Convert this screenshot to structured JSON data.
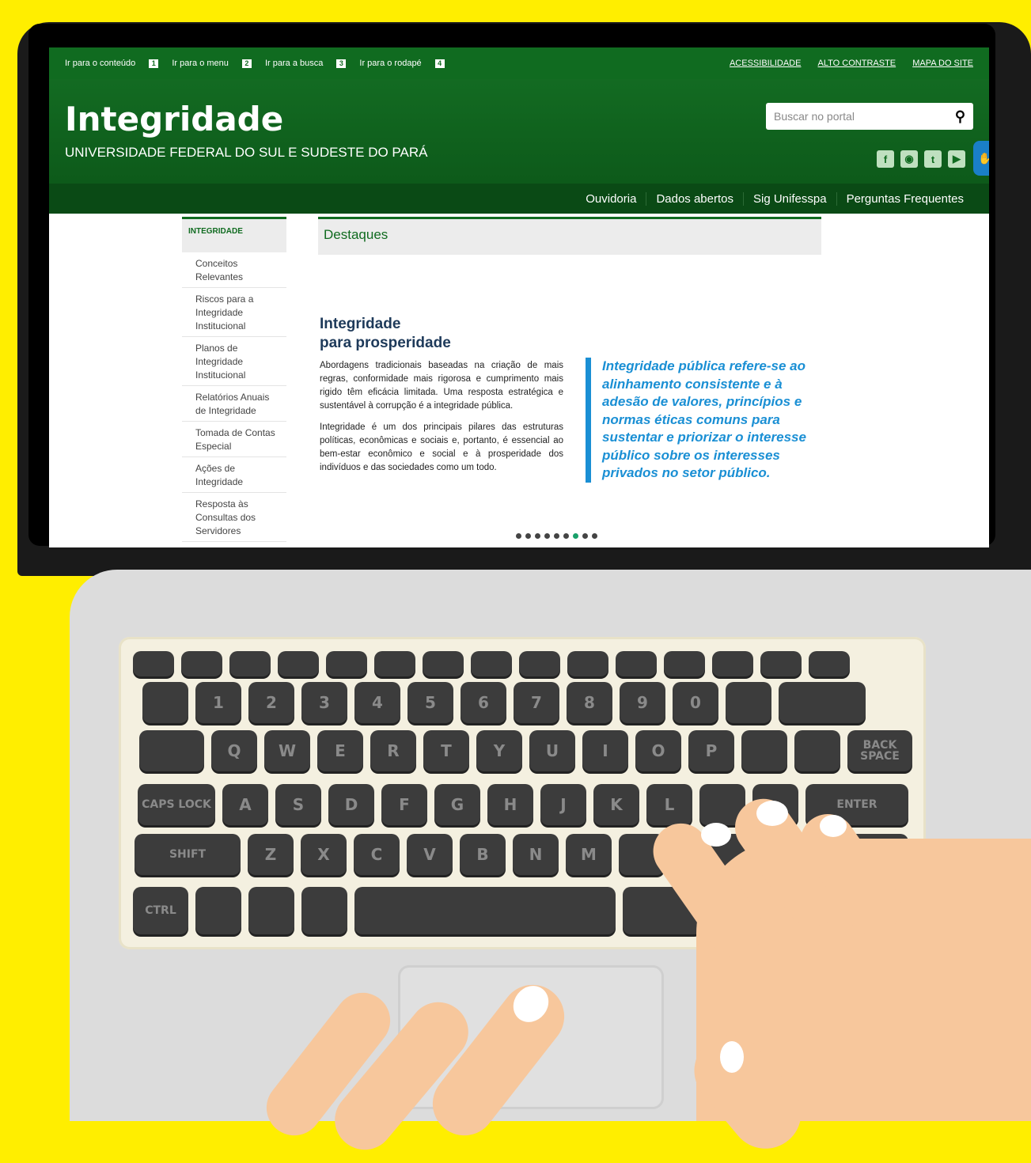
{
  "topbar": {
    "skip_links": [
      {
        "label": "Ir para o conteúdo",
        "num": "1"
      },
      {
        "label": "Ir para o menu",
        "num": "2"
      },
      {
        "label": "Ir para a busca",
        "num": "3"
      },
      {
        "label": "Ir para o rodapé",
        "num": "4"
      }
    ],
    "links": [
      "ACESSIBILIDADE",
      "ALTO CONTRASTE",
      "MAPA DO SITE"
    ]
  },
  "header": {
    "title": "Integridade",
    "subtitle": "UNIVERSIDADE FEDERAL DO SUL E SUDESTE DO PARÁ",
    "search_placeholder": "Buscar no portal",
    "social": [
      "facebook-icon",
      "instagram-icon",
      "twitter-icon",
      "youtube-icon"
    ]
  },
  "nav": [
    "Ouvidoria",
    "Dados abertos",
    "Sig Unifesspa",
    "Perguntas Frequentes"
  ],
  "sidebar": {
    "heading": "INTEGRIDADE",
    "items": [
      "Conceitos Relevantes",
      "Riscos para a Integridade Institucional",
      "Planos de Integridade Institucional",
      "Relatórios Anuais de Integridade",
      "Tomada de Contas Especial",
      "Ações de Integridade",
      "Resposta às Consultas dos Servidores"
    ]
  },
  "main": {
    "section": "Destaques",
    "heading_1": "Integridade",
    "heading_2": "para prosperidade",
    "paragraph_1": "Abordagens tradicionais baseadas na criação de mais regras, conformidade mais rigorosa e cumprimento mais rigido têm eficácia limitada. Uma resposta estratégica e sustentável à corrupção é a integridade pública.",
    "paragraph_2": "Integridade é um dos principais pilares das estruturas políticas, econômicas e sociais e, portanto, é essencial ao bem-estar econômico e social e à prosperidade dos indivíduos e das sociedades como um todo.",
    "quote": "Integridade pública refere-se ao alinhamento consistente e à adesão de valores, princípios e normas éticas comuns para sustentar e priorizar o interesse público sobre os interesses privados no setor público.",
    "carousel": {
      "total": 9,
      "active": 7
    }
  },
  "keyboard": {
    "row1": [
      "",
      "",
      "",
      "",
      "",
      "",
      "",
      "",
      "",
      "",
      "",
      "",
      "",
      "",
      ""
    ],
    "row2": [
      "",
      "1",
      "2",
      "3",
      "4",
      "5",
      "6",
      "7",
      "8",
      "9",
      "0",
      "",
      ""
    ],
    "row3": [
      "",
      "Q",
      "W",
      "E",
      "R",
      "T",
      "Y",
      "U",
      "I",
      "O",
      "P",
      "",
      "",
      "BACK SPACE"
    ],
    "row4": [
      "CAPS LOCK",
      "A",
      "S",
      "D",
      "F",
      "G",
      "H",
      "J",
      "K",
      "L",
      "",
      "",
      "ENTER"
    ],
    "row5": [
      "SHIFT",
      "Z",
      "X",
      "C",
      "V",
      "B",
      "N",
      "M",
      "",
      "",
      ""
    ],
    "row6": [
      "CTRL",
      "",
      "",
      "",
      "",
      "",
      ""
    ]
  },
  "colors": {
    "background": "#ffee00",
    "brand_green": "#106b20",
    "accent_blue": "#1a8fd4"
  }
}
